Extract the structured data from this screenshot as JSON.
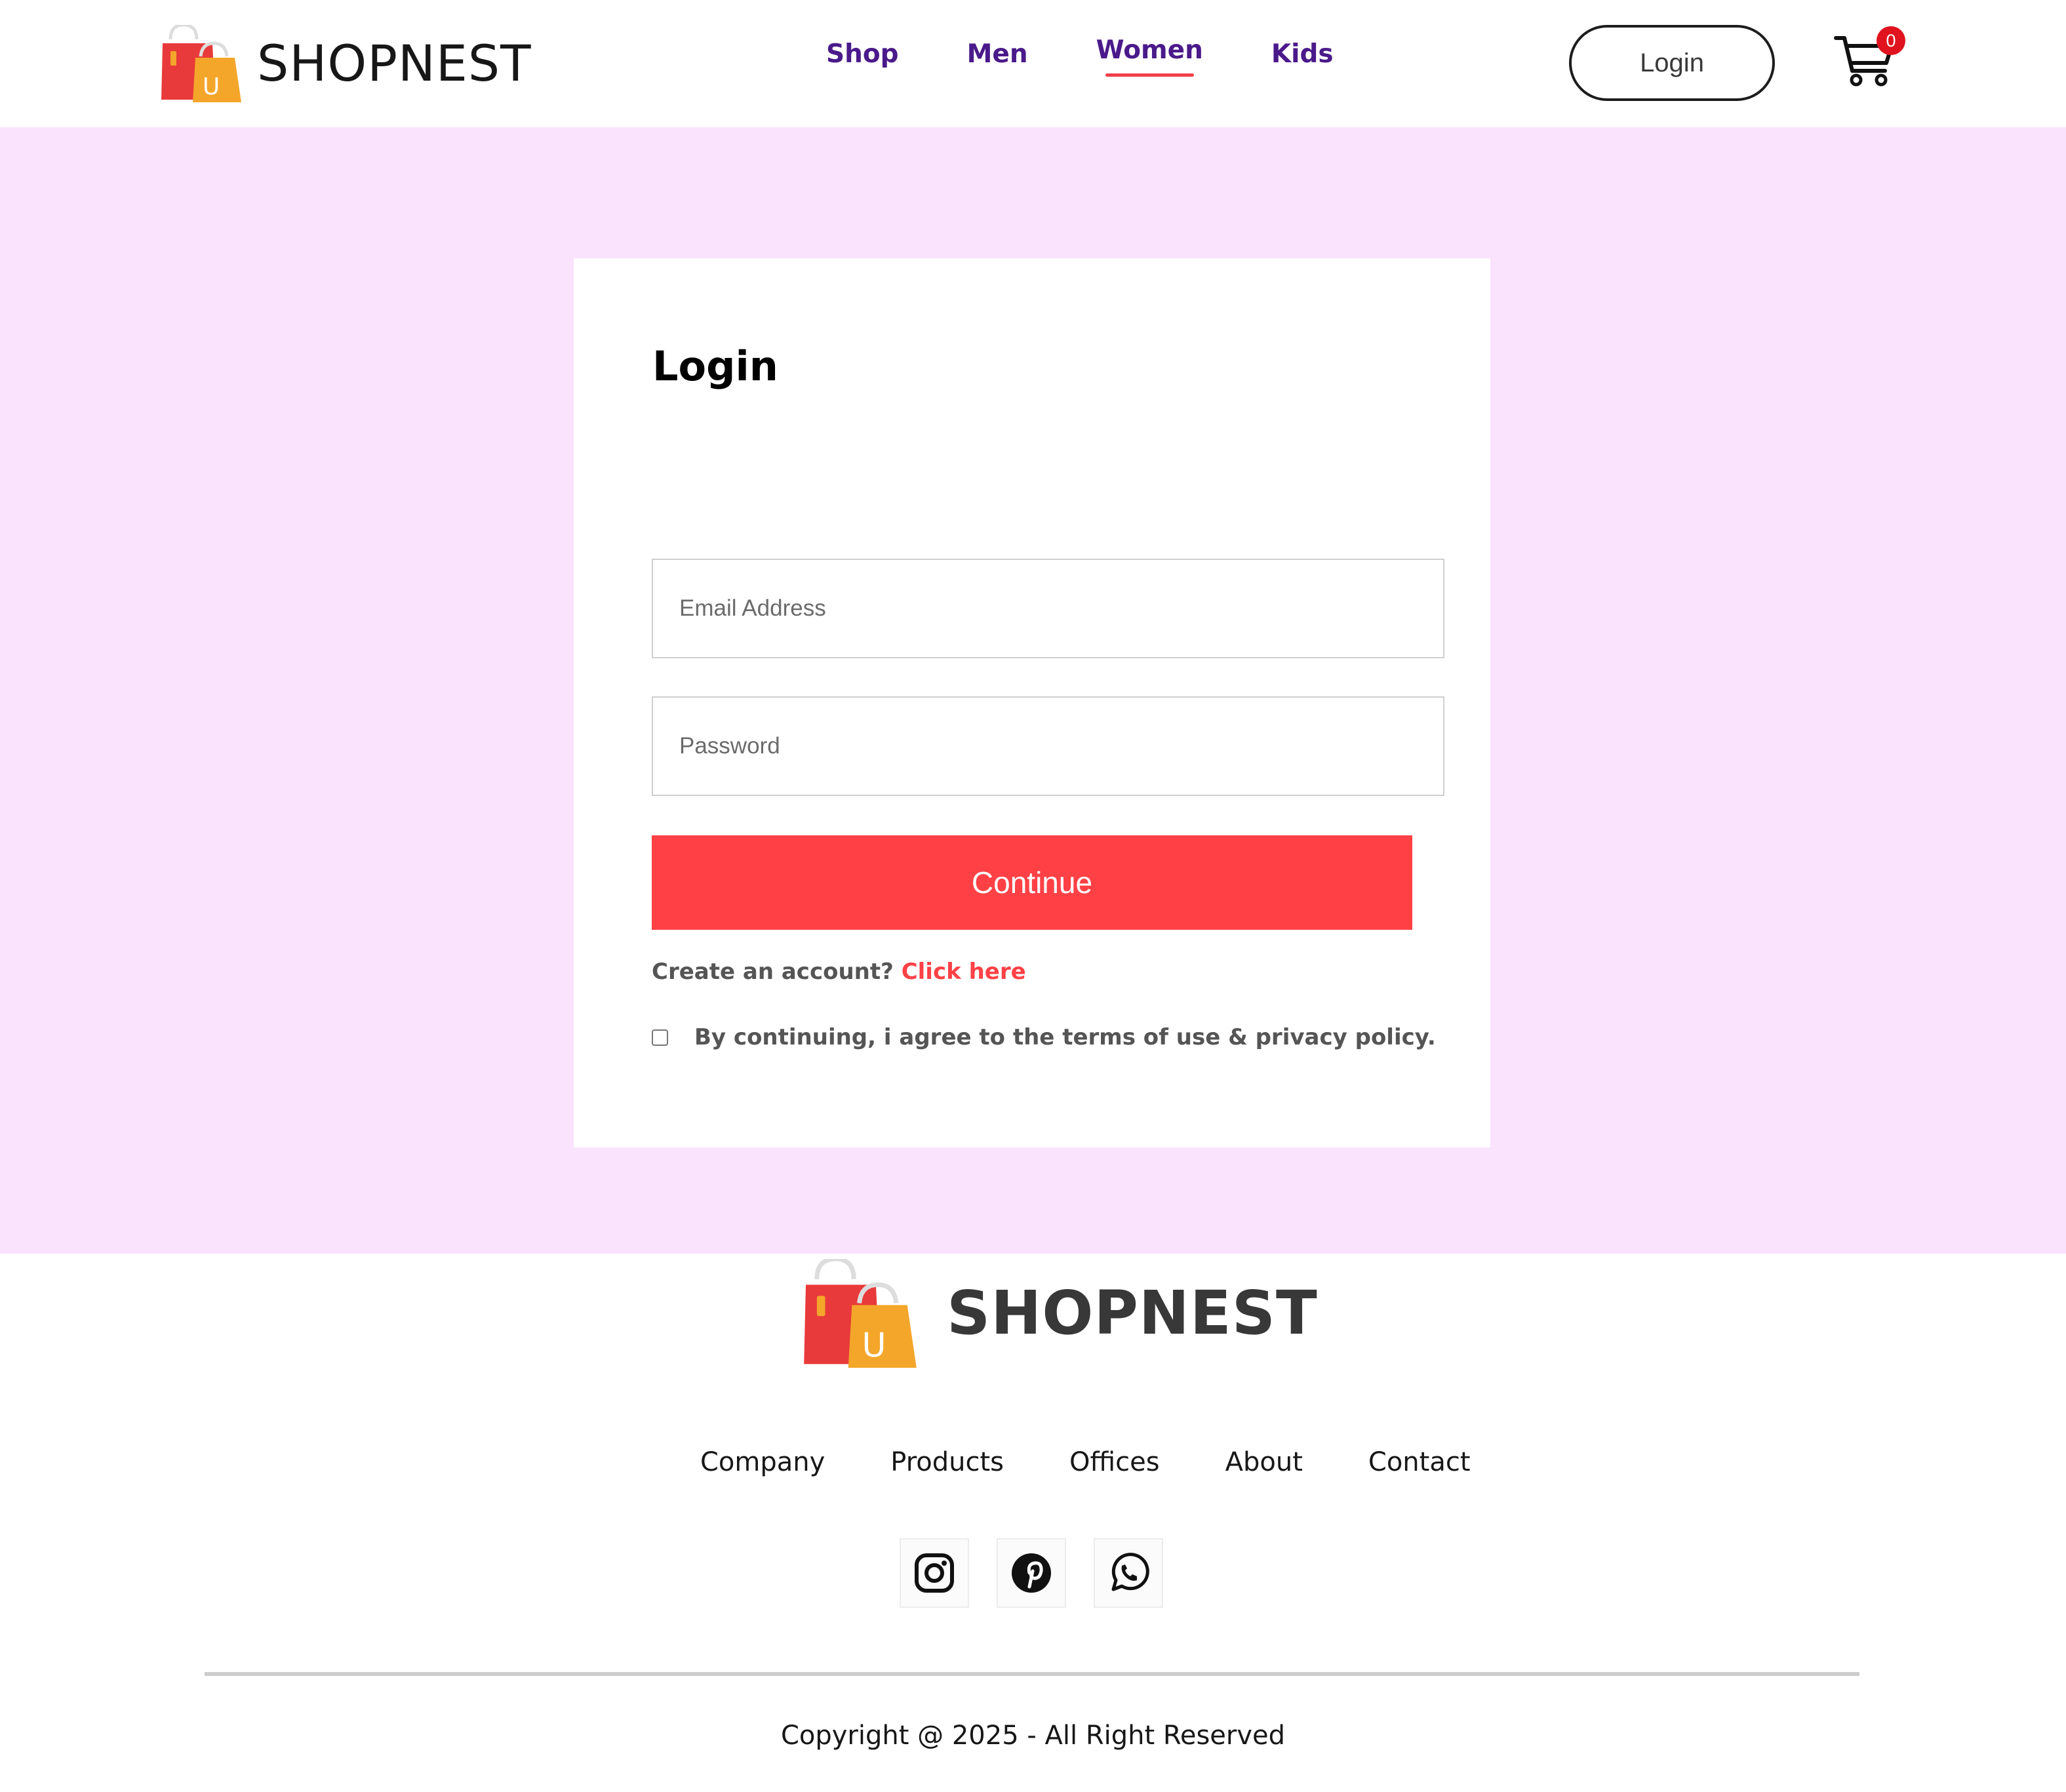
{
  "header": {
    "brand_name": "SHOPNEST",
    "nav": [
      {
        "label": "Shop"
      },
      {
        "label": "Men"
      },
      {
        "label": "Women",
        "active": true
      },
      {
        "label": "Kids"
      }
    ],
    "login_label": "Login",
    "cart_count": "0"
  },
  "login_form": {
    "title": "Login",
    "email_placeholder": "Email Address",
    "password_placeholder": "Password",
    "continue_label": "Continue",
    "signup_prompt": "Create an account?",
    "signup_link": "Click here",
    "agree_text": "By continuing, i agree to the terms of use & privacy policy.",
    "agree_checked": false
  },
  "footer": {
    "brand_name": "SHOPNEST",
    "links": [
      "Company",
      "Products",
      "Offices",
      "About",
      "Contact"
    ],
    "social_icons": [
      "instagram-icon",
      "pinterest-icon",
      "whatsapp-icon"
    ],
    "copyright": "Copyright @ 2025 - All Right Reserved"
  },
  "colors": {
    "accent": "#ff4146",
    "nav_text": "#4a1a8a",
    "main_background": "#fae3fd",
    "badge": "#e0131e"
  }
}
